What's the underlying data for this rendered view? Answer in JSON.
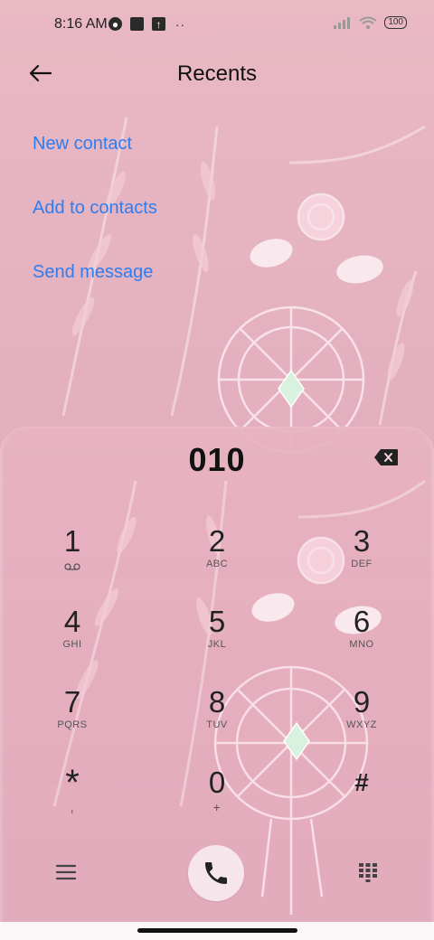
{
  "status_bar": {
    "time": "8:16 AM",
    "left_icons": [
      "notification-app-icon",
      "notification-square-icon",
      "upload-icon",
      "more-dots-icon"
    ],
    "right_icons": [
      "signal-icon",
      "wifi-icon",
      "battery-icon"
    ],
    "battery": "100"
  },
  "header": {
    "title": "Recents",
    "back_icon": "arrow-left-icon"
  },
  "actions": [
    {
      "label": "New contact"
    },
    {
      "label": "Add to contacts"
    },
    {
      "label": "Send message"
    }
  ],
  "dialpad": {
    "number": "010",
    "keys": [
      {
        "digit": "1",
        "letters": ""
      },
      {
        "digit": "2",
        "letters": "ABC"
      },
      {
        "digit": "3",
        "letters": "DEF"
      },
      {
        "digit": "4",
        "letters": "GHI"
      },
      {
        "digit": "5",
        "letters": "JKL"
      },
      {
        "digit": "6",
        "letters": "MNO"
      },
      {
        "digit": "7",
        "letters": "PQRS"
      },
      {
        "digit": "8",
        "letters": "TUV"
      },
      {
        "digit": "9",
        "letters": "WXYZ"
      },
      {
        "digit": "*",
        "letters": ","
      },
      {
        "digit": "0",
        "letters": "+"
      },
      {
        "digit": "#",
        "letters": ""
      }
    ]
  },
  "bottom_bar": {
    "menu_icon": "menu-icon",
    "call_icon": "phone-icon",
    "keypad_icon": "dialpad-icon"
  },
  "colors": {
    "accent": "#2e7df0",
    "background": "#e4b0bf",
    "call_button": "#f6e6ec"
  }
}
